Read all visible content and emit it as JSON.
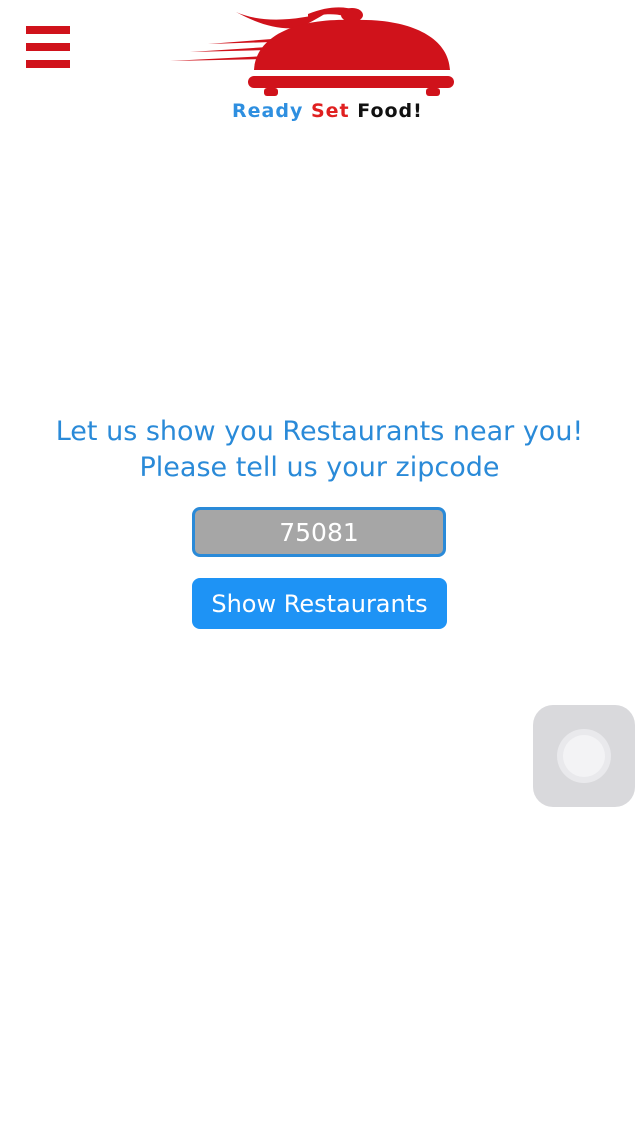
{
  "header": {
    "logo": {
      "word1": "Ready",
      "word2": "Set",
      "word3": "Food!"
    }
  },
  "main": {
    "prompt_line1": "Let us show you Restaurants near you!",
    "prompt_line2": "Please tell us your zipcode",
    "zip_value": "75081",
    "show_button_label": "Show Restaurants"
  },
  "colors": {
    "brand_red": "#d0121b",
    "accent_blue": "#1e93f5",
    "text_blue": "#2a8ad8",
    "input_gray": "#a6a6a6"
  },
  "icons": {
    "menu": "hamburger-menu-icon",
    "logo": "food-cloche-icon",
    "assistive": "assistive-touch-icon"
  }
}
